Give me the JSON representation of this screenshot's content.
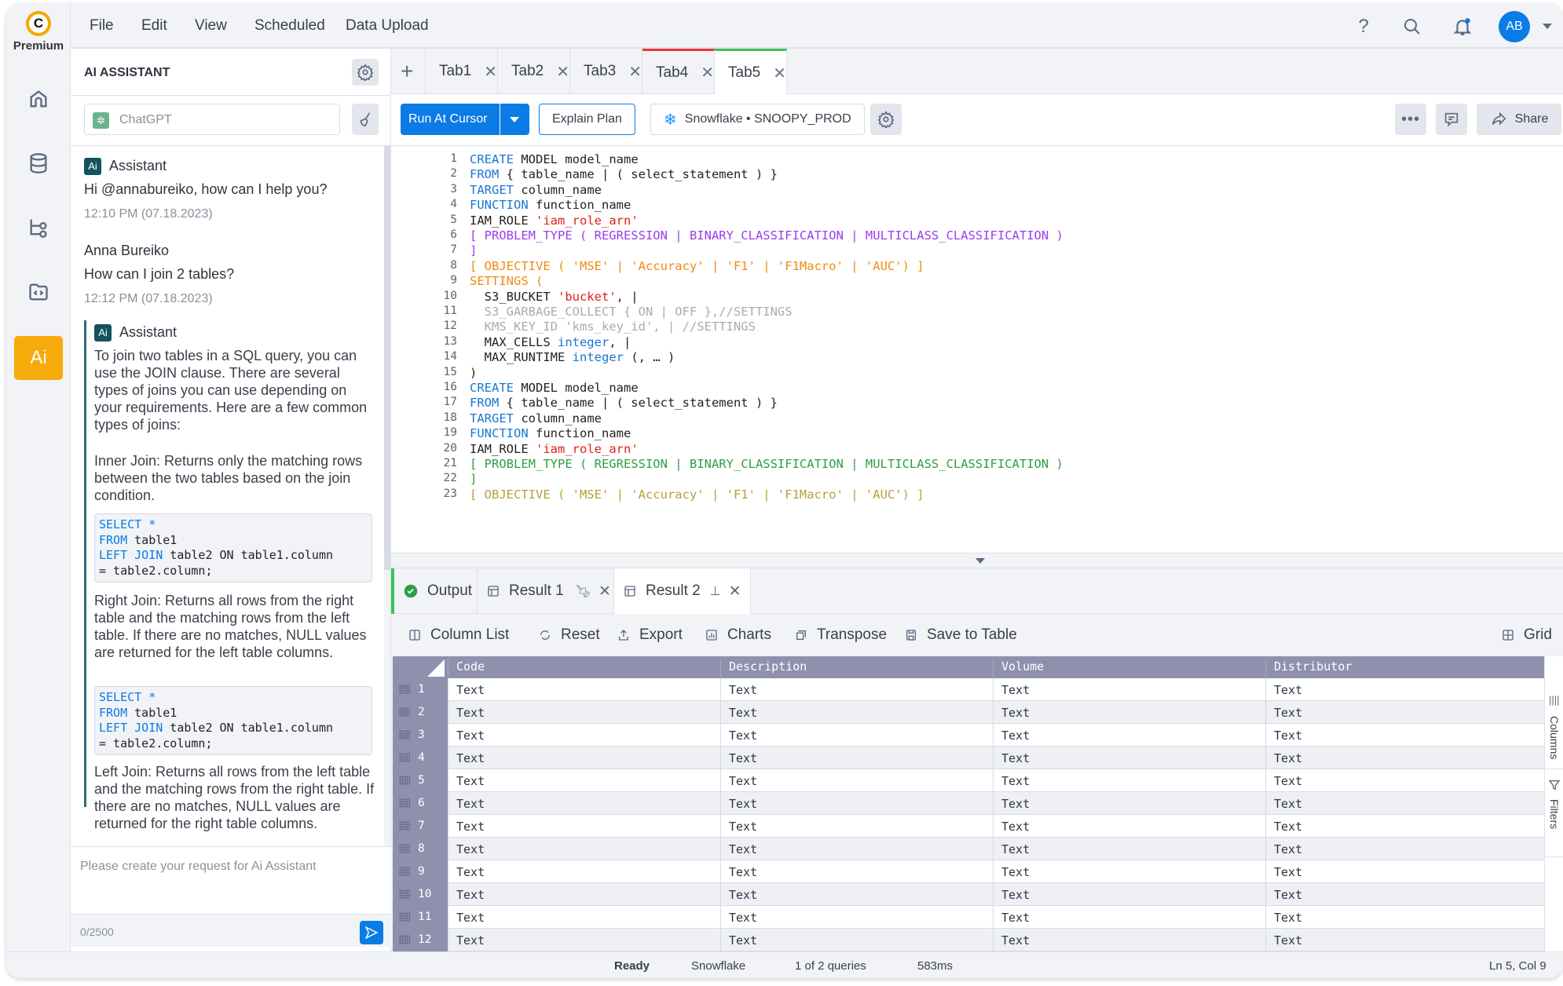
{
  "app": {
    "tier": "Premium",
    "logo_letter": "C",
    "ai_rail_label": "Ai"
  },
  "menu": [
    "File",
    "Edit",
    "View",
    "Scheduled",
    "Data Upload"
  ],
  "user": {
    "initials": "AB",
    "avatar_color": "#0b7be5"
  },
  "ai_panel": {
    "title": "AI ASSISTANT",
    "model": "ChatGPT",
    "messages": [
      {
        "author": "Assistant",
        "text": "Hi @annabureiko, how can I help you?",
        "time": "12:10 PM (07.18.2023)"
      },
      {
        "author": "Anna Bureiko",
        "text": "How can I join 2 tables?",
        "time": "12:12 PM (07.18.2023)"
      }
    ],
    "answer": {
      "author": "Assistant",
      "intro": "To join two tables in a SQL query, you can use the JOIN clause. There are several types of joins you can use depending on your requirements. Here are a few common types of joins:",
      "inner": "Inner Join: Returns only the matching rows between the two tables based on the join condition.",
      "right": "Right Join: Returns all rows from the right table and the matching rows from the left table. If there are no matches, NULL values are returned for the left table columns.",
      "left": "Left Join: Returns all rows from the left table and the matching rows from the right table. If there are no matches, NULL values are returned for the right table columns.",
      "code": {
        "l1kw": "SELECT *",
        "l2kw": "FROM",
        "l2": " table1",
        "l3kw": "LEFT JOIN",
        "l3": " table2 ON table1.column",
        "l4": "= table2.column;"
      }
    },
    "input_placeholder": "Please create your request for Ai Assistant",
    "char_count": "0/2500"
  },
  "tabs": [
    {
      "label": "Tab1"
    },
    {
      "label": "Tab2"
    },
    {
      "label": "Tab3"
    },
    {
      "label": "Tab4",
      "marker": "#e53935"
    },
    {
      "label": "Tab5",
      "marker": "#3cc455",
      "active": true
    }
  ],
  "toolbar": {
    "run": "Run At Cursor",
    "explain": "Explain Plan",
    "connection": "Snowflake • SNOOPY_PROD",
    "share": "Share"
  },
  "editor": {
    "lines": [
      [
        [
          "blue",
          "CREATE"
        ],
        [
          "",
          "MODEL model_name"
        ]
      ],
      [
        [
          "blue",
          "FROM"
        ],
        [
          "",
          "{ table_name | ( select_statement ) }"
        ]
      ],
      [
        [
          "blue",
          "TARGET"
        ],
        [
          "",
          "column_name"
        ]
      ],
      [
        [
          "blue",
          "FUNCTION"
        ],
        [
          "",
          "function_name"
        ]
      ],
      [
        [
          "",
          "IAM_ROLE "
        ],
        [
          "red",
          "'iam_role_arn'"
        ]
      ],
      [
        [
          "purple",
          "[ PROBLEM_TYPE ( REGRESSION | BINARY_CLASSIFICATION | MULTICLASS_CLASSIFICATION )"
        ]
      ],
      [
        [
          "purple",
          "]"
        ]
      ],
      [
        [
          "orange",
          "[ OBJECTIVE ( 'MSE' | 'Accuracy' | 'F1' | 'F1Macro' | 'AUC') ]"
        ]
      ],
      [
        [
          "orange",
          "SETTINGS ("
        ]
      ],
      [
        [
          "",
          "  S3_BUCKET "
        ],
        [
          "red",
          "'bucket'"
        ],
        [
          "",
          ", |"
        ]
      ],
      [
        [
          "gray",
          "  S3_GARBAGE_COLLECT { ON | OFF },//SETTINGS"
        ]
      ],
      [
        [
          "gray",
          "  KMS_KEY_ID 'kms_key_id', | //SETTINGS"
        ]
      ],
      [
        [
          "",
          "  MAX_CELLS "
        ],
        [
          "blue",
          "integer"
        ],
        [
          "",
          ", |"
        ]
      ],
      [
        [
          "",
          "  MAX_RUNTIME "
        ],
        [
          "blue",
          "integer"
        ],
        [
          "",
          " (, … )"
        ]
      ],
      [
        [
          "",
          ")"
        ]
      ],
      [
        [
          "blue",
          "CREATE"
        ],
        [
          "",
          "MODEL model_name"
        ]
      ],
      [
        [
          "blue",
          "FROM"
        ],
        [
          "",
          "{ table_name | ( select_statement ) }"
        ]
      ],
      [
        [
          "blue",
          "TARGET"
        ],
        [
          "",
          "column_name"
        ]
      ],
      [
        [
          "blue",
          "FUNCTION"
        ],
        [
          "",
          "function_name"
        ]
      ],
      [
        [
          "",
          "IAM_ROLE "
        ],
        [
          "red",
          "'iam_role_arn'"
        ]
      ],
      [
        [
          "green",
          "[ PROBLEM_TYPE ( REGRESSION | BINARY_CLASSIFICATION | MULTICLASS_CLASSIFICATION )"
        ]
      ],
      [
        [
          "green",
          "]"
        ]
      ],
      [
        [
          "olive",
          "[ OBJECTIVE ( 'MSE' | 'Accuracy' | 'F1' | 'F1Macro' | 'AUC') ]"
        ]
      ]
    ]
  },
  "results": {
    "tabs": [
      {
        "label": "Output",
        "status": "success"
      },
      {
        "label": "Result 1"
      },
      {
        "label": "Result 2",
        "active": true
      }
    ],
    "actions": [
      "Column List",
      "Reset",
      "Export",
      "Charts",
      "Transpose",
      "Save to Table"
    ],
    "view": "Grid",
    "columns": [
      "Code",
      "Description",
      "Volume",
      "Distributor"
    ],
    "rows": [
      [
        "Text",
        "Text",
        "Text",
        "Text"
      ],
      [
        "Text",
        "Text",
        "Text",
        "Text"
      ],
      [
        "Text",
        "Text",
        "Text",
        "Text"
      ],
      [
        "Text",
        "Text",
        "Text",
        "Text"
      ],
      [
        "Text",
        "Text",
        "Text",
        "Text"
      ],
      [
        "Text",
        "Text",
        "Text",
        "Text"
      ],
      [
        "Text",
        "Text",
        "Text",
        "Text"
      ],
      [
        "Text",
        "Text",
        "Text",
        "Text"
      ],
      [
        "Text",
        "Text",
        "Text",
        "Text"
      ],
      [
        "Text",
        "Text",
        "Text",
        "Text"
      ],
      [
        "Text",
        "Text",
        "Text",
        "Text"
      ],
      [
        "Text",
        "Text",
        "Text",
        "Text"
      ]
    ],
    "side": [
      "Columns",
      "Filters"
    ]
  },
  "status": {
    "state": "Ready",
    "engine": "Snowflake",
    "queries": "1 of 2 queries",
    "time": "583ms",
    "cursor": "Ln 5, Col 9"
  }
}
